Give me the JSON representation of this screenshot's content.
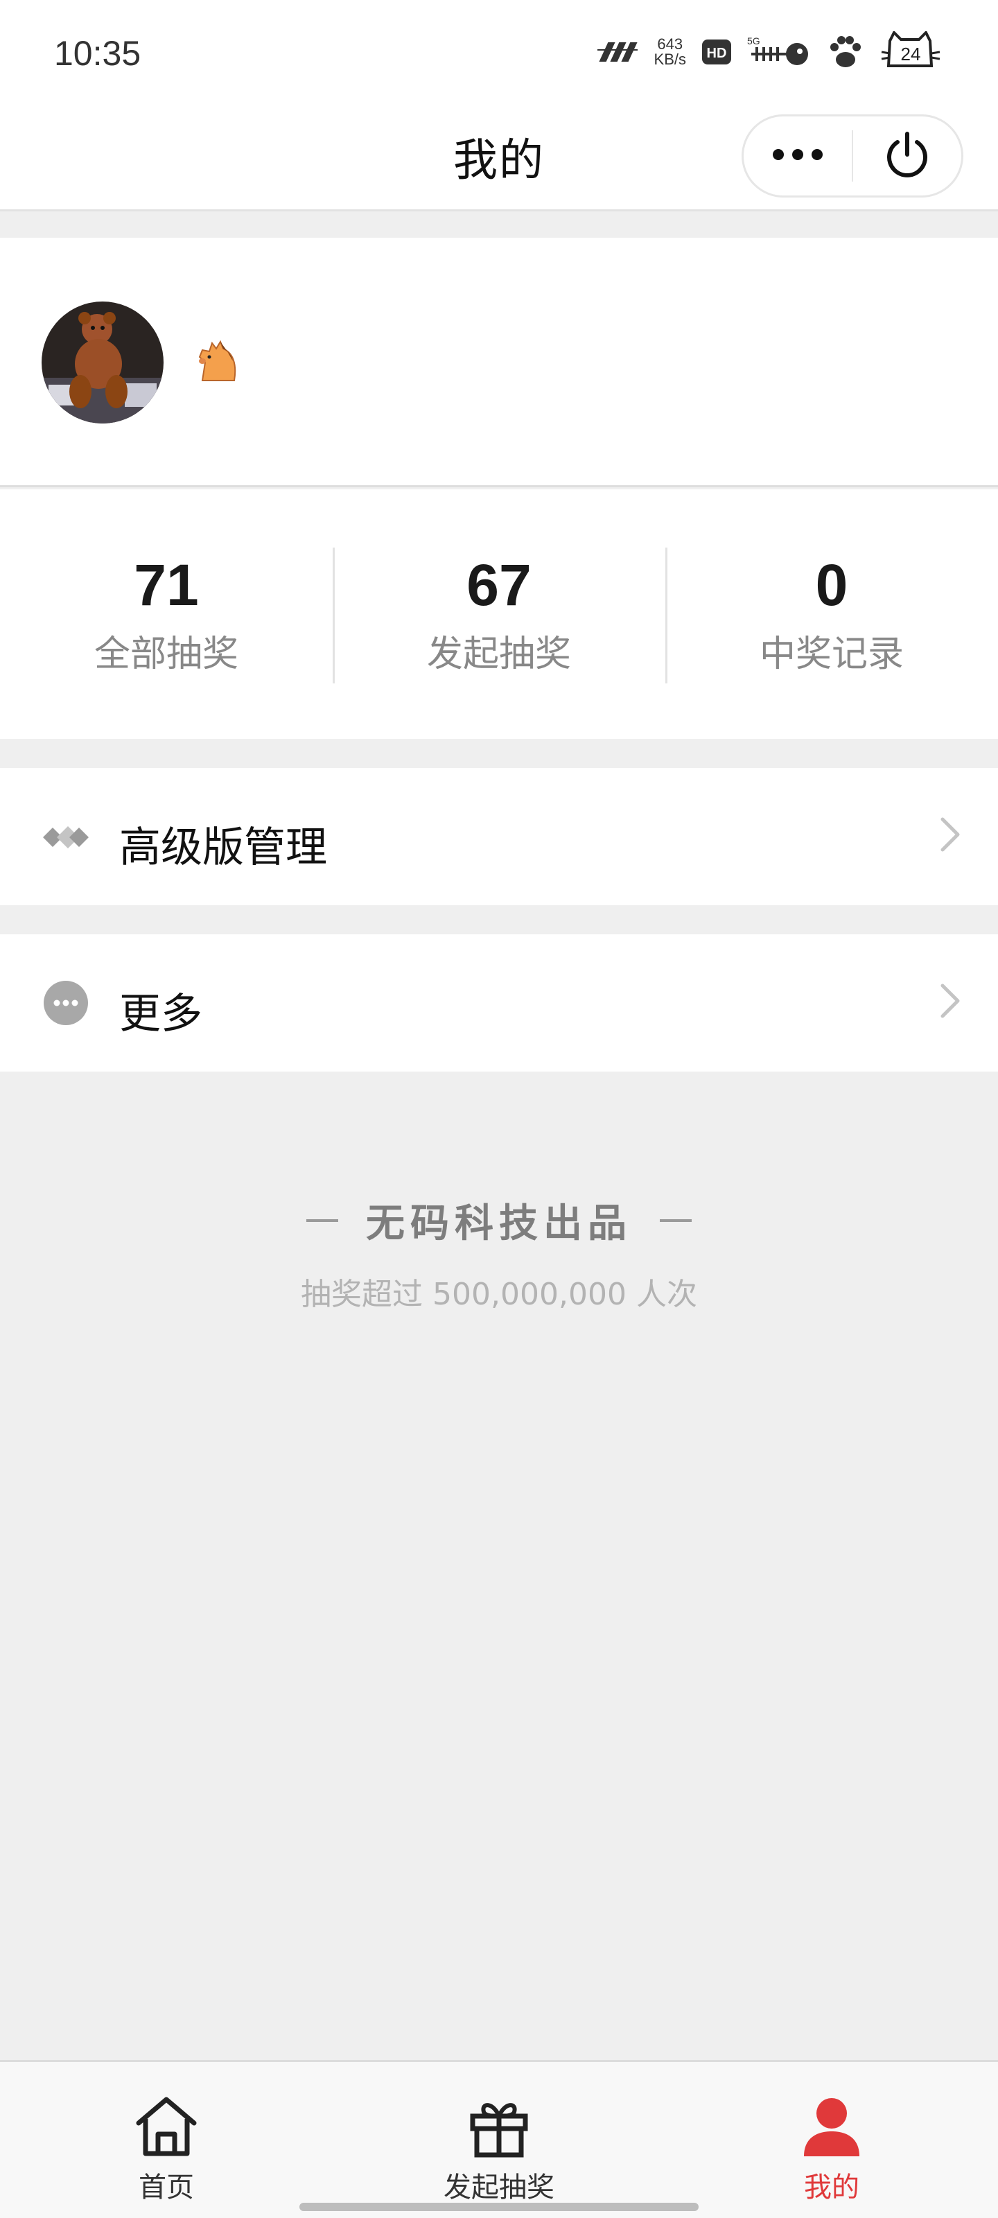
{
  "status_bar": {
    "time": "10:35",
    "net_speed_value": "643",
    "net_speed_unit": "KB/s",
    "network": "5G",
    "battery": "24",
    "icons": [
      "signal-icon",
      "hd-icon",
      "fishbone-icon",
      "paw-icon",
      "battery-cat-icon"
    ]
  },
  "header": {
    "title": "我的",
    "more_icon": "more-dots-icon",
    "power_icon": "power-icon"
  },
  "profile": {
    "avatar": "teddy-bear-photo",
    "nickname_emoji": "🐴"
  },
  "stats": [
    {
      "value": "71",
      "label": "全部抽奖"
    },
    {
      "value": "67",
      "label": "发起抽奖"
    },
    {
      "value": "0",
      "label": "中奖记录"
    }
  ],
  "menu": {
    "premium": {
      "label": "高级版管理",
      "icon": "diamond-icon"
    },
    "more": {
      "label": "更多",
      "icon": "more-circle-icon"
    }
  },
  "brand": {
    "title": "无码科技出品",
    "subtitle": "抽奖超过 500,000,000 人次"
  },
  "tabs": [
    {
      "label": "首页",
      "icon": "home-icon",
      "active": false
    },
    {
      "label": "发起抽奖",
      "icon": "gift-icon",
      "active": false
    },
    {
      "label": "我的",
      "icon": "user-icon",
      "active": true
    }
  ],
  "colors": {
    "accent": "#e0393a",
    "background": "#efefef"
  }
}
